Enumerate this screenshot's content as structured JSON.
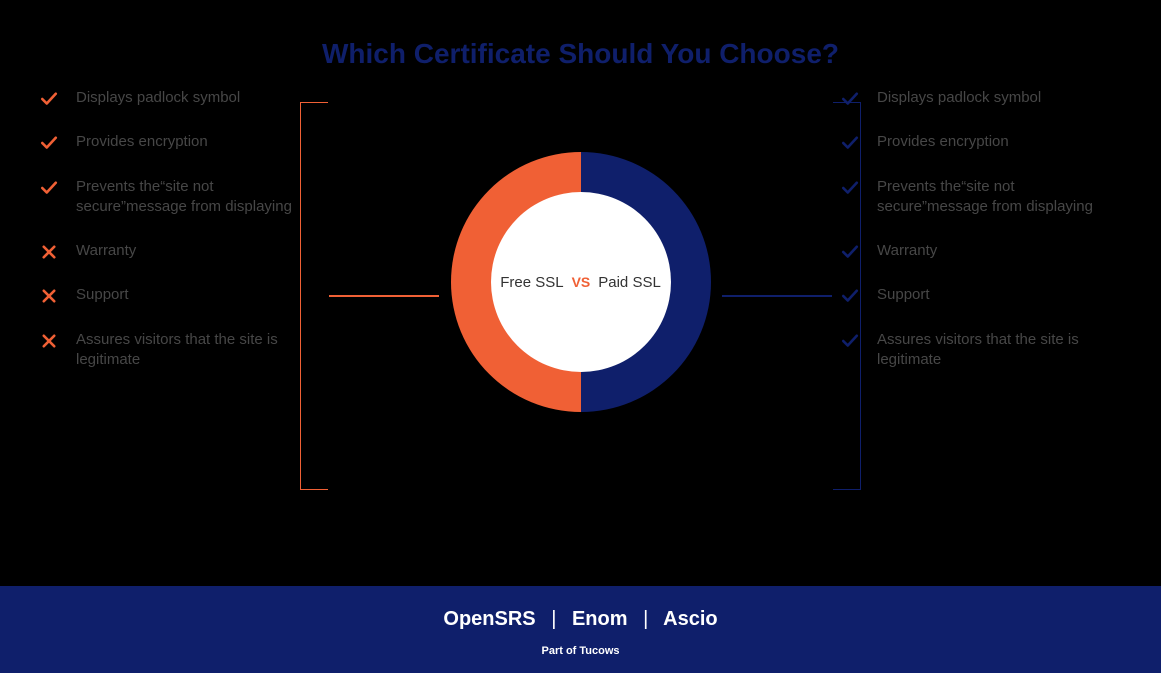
{
  "title": "Which Certificate Should You Choose?",
  "center": {
    "left": "Free SSL",
    "vs": "VS",
    "right": "Paid SSL"
  },
  "left_items": [
    {
      "icon": "check",
      "text": "Displays padlock symbol"
    },
    {
      "icon": "check",
      "text": "Provides encryption"
    },
    {
      "icon": "check",
      "text": "Prevents the“site not secure”message from displaying"
    },
    {
      "icon": "cross",
      "text": "Warranty"
    },
    {
      "icon": "cross",
      "text": "Support"
    },
    {
      "icon": "cross",
      "text": "Assures visitors that the site is legitimate"
    }
  ],
  "right_items": [
    {
      "icon": "check",
      "text": "Displays padlock symbol"
    },
    {
      "icon": "check",
      "text": "Provides encryption"
    },
    {
      "icon": "check",
      "text": "Prevents the“site not secure”message from displaying"
    },
    {
      "icon": "check",
      "text": "Warranty"
    },
    {
      "icon": "check",
      "text": "Support"
    },
    {
      "icon": "check",
      "text": "Assures visitors that the site is legitimate"
    }
  ],
  "footer": {
    "brands": [
      "OpenSRS",
      "Enom",
      "Ascio"
    ],
    "sep": "|",
    "tagline": "Part of Tucows"
  },
  "colors": {
    "orange": "#f06035",
    "navy": "#0f1f6b"
  }
}
